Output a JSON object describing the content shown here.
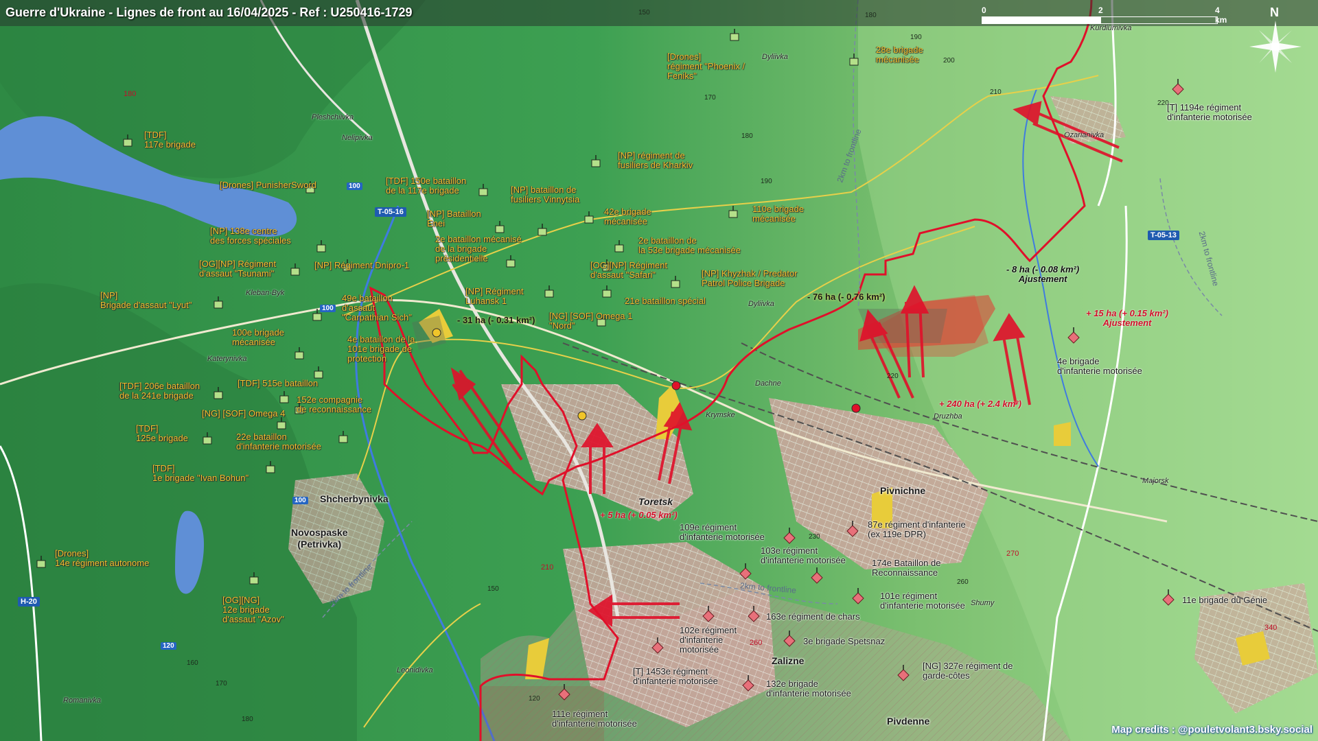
{
  "title": "Guerre d'Ukraine - Lignes de front au 16/04/2025 - Ref : U250416-1729",
  "scale": {
    "start": "0",
    "mid": "2",
    "end": "4 km"
  },
  "north": "N",
  "credit": "Map credits : @pouletvolant3.bsky.social",
  "roads": {
    "t0516": "T-05-16",
    "t0513": "T-05-13",
    "h20": "H-20",
    "r100a": "100",
    "r100b": "100",
    "r100c": "100",
    "r120": "120"
  },
  "towns": {
    "toretsk": "Toretsk",
    "shcherbynivka": "Shcherbynivka",
    "novospaske": "Novospaske\n(Petrivka)",
    "pivnichne": "Pivnichne",
    "zalizne": "Zalizne",
    "pivdenne": "Pivdenne"
  },
  "villages": {
    "pleshchiivka": "Pleshchiivka",
    "nelipivka": "Nelipivka",
    "klebanbyk": "Kleban-Byk",
    "katerynivka": "Katerynivka",
    "dyliivka_top": "Dyliivka",
    "dyliivka": "Dyliivka",
    "dachne": "Dachne",
    "krymske": "Krymske",
    "druzhba": "Druzhba",
    "kurdiumivka": "Kurdiumivka",
    "ozarianivka": "Ozarianivka",
    "majorsk": "Majorsk",
    "shumy": "Shumy",
    "leonidivka": "Leonidivka",
    "romanivka": "Romanivka"
  },
  "elevations": [
    "150",
    "180",
    "190",
    "200",
    "170",
    "180",
    "190",
    "210",
    "220",
    "180",
    "230",
    "260",
    "150",
    "160",
    "170",
    "180",
    "120",
    "220"
  ],
  "elevations_red": [
    "180",
    "210",
    "270",
    "340",
    "260"
  ],
  "frontline_labels": {
    "a": "2km to frontline",
    "b": "2km to frontline",
    "c": "2km to frontline",
    "d": "2km to frontline"
  },
  "changes": {
    "minus76": "- 76 ha (- 0.76 km²)",
    "minus31": "- 31 ha (- 0.31 km²)",
    "minus8": "- 8 ha (- 0.08 km²)\nAjustement",
    "plus15": "+ 15 ha (+ 0.15 km²)\nAjustement",
    "plus240": "+ 240 ha (+ 2.4 km²)",
    "plus5": "+ 5 ha (+ 0.05 km²)"
  },
  "ua_units": [
    "[TDF]\n117e brigade",
    "[Drones] PunisherSword",
    "[TDF] 150e bataillon\nde la 117e brigade",
    "[NP] 138e centre\ndes forces spéciales",
    "[OG][NP] Régiment\nd'assaut \"Tsunami\"",
    "[NP] Régiment Dnipro-1",
    "[NP]\nBrigade d'assaut \"Lyut\"",
    "49e bataillon\nd'assaut\n\"Carpathian Sich\"",
    "100e brigade\nmécanisée",
    "4e bataillon de la\n101e brigade de\nprotection",
    "[TDF] 206e bataillon\nde la 241e brigade",
    "[TDF] 515e bataillon",
    "152e compagnie\nde reconnaissance",
    "[NG] [SOF] Omega 4",
    "[TDF]\n125e brigade",
    "22e bataillon\nd'infanterie motorisée",
    "[TDF]\n1e brigade \"Ivan Bohun\"",
    "[Drones]\n14e régiment autonome",
    "[OG][NG]\n12e brigade\nd'assaut \"Azov\"",
    "[NP] Bataillon\nEnei",
    "2e bataillon mécanisé\nde la brigade\nprésidentielle",
    "[NP] bataillon de\nfusiliers Vinnytsia",
    "42e brigade\nmécanisée",
    "2e bataillon de\nla 53e brigade mécanisée",
    "[OG][NP] Régiment\nd'assaut \"Safari\"",
    "[NP] Régiment\nLuhansk 1",
    "21e bataillon spécial",
    "[NG] [SOF] Omega 1\n\"Nord\"",
    "[NP] Khyzhak / Predator\nPatrol Police Brigade",
    "[NP] régiment de\nfusiliers de Kharkiv",
    "[Drones]\nrégiment \"Phoenix /\nFeniks\"",
    "28e brigade\nmécanisée",
    "110e brigade\nmécanisée"
  ],
  "ru_units": [
    "[T] 1194e régiment\nd'infanterie motorisée",
    "4e brigade\nd'infanterie motorisée",
    "109e régiment\nd'infanterie motorisée",
    "87e régiment d'infanterie\n(ex 119e DPR)",
    "103e régiment\nd'infanterie motorisée",
    "174e Bataillon de\nReconnaissance",
    "101e régiment\nd'infanterie motorisée",
    "163e régiment de chars",
    "102e régiment\nd'infanterie\nmotorisée",
    "3e brigade Spetsnaz",
    "[T] 1453e régiment\nd'infanterie motorisée",
    "132e brigade\nd'infanterie motorisée",
    "[NG] 327e régiment de\ngarde-côtes",
    "111e régiment\nd'infanterie motorisée",
    "11e brigade du Génie"
  ],
  "colors": {
    "ua_marker": "#b4e08a",
    "ru_marker": "#e8707a",
    "front": "#e0102a",
    "lake": "#5f8fd6",
    "gain": "#e43a30"
  }
}
